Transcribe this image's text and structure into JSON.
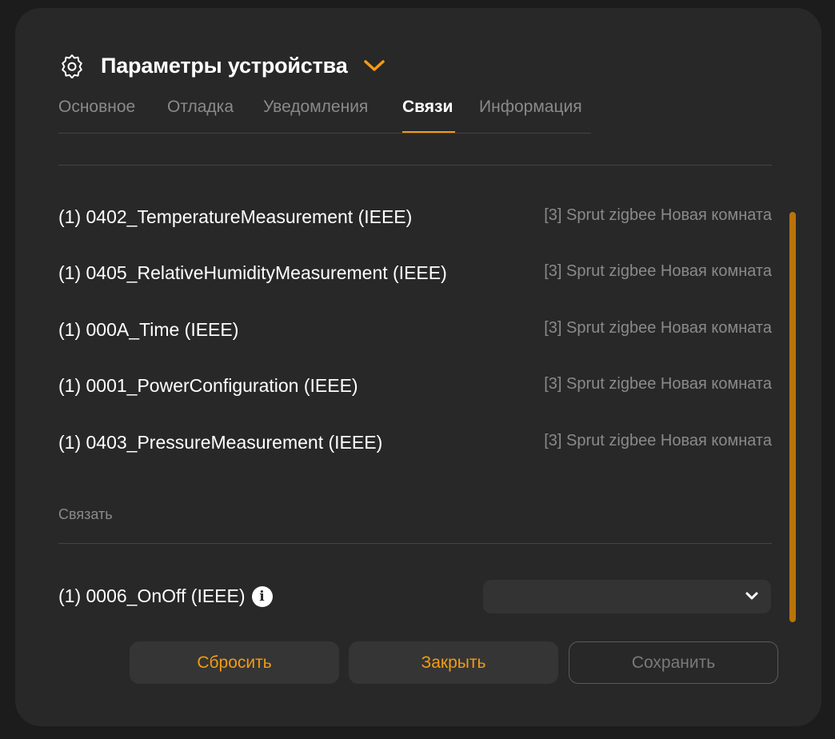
{
  "modal": {
    "title": "Параметры устройства",
    "icons": {
      "settings": "gear-icon",
      "expand": "chevron-down-icon"
    }
  },
  "tabs": [
    {
      "label": "Основное",
      "active": false
    },
    {
      "label": "Отладка",
      "active": false
    },
    {
      "label": "Уведомления",
      "active": false
    },
    {
      "label": "Связи",
      "active": true
    },
    {
      "label": "Информация",
      "active": false
    }
  ],
  "bindings": [
    {
      "name": "(1) 0402_TemperatureMeasurement (IEEE)",
      "target": "[3] Sprut zigbee Новая комната"
    },
    {
      "name": "(1) 0405_RelativeHumidityMeasurement (IEEE)",
      "target": "[3] Sprut zigbee Новая комната"
    },
    {
      "name": "(1) 000A_Time (IEEE)",
      "target": "[3] Sprut zigbee Новая комната"
    },
    {
      "name": "(1) 0001_PowerConfiguration (IEEE)",
      "target": "[3] Sprut zigbee Новая комната"
    },
    {
      "name": "(1) 0403_PressureMeasurement (IEEE)",
      "target": "[3] Sprut zigbee Новая комната"
    }
  ],
  "link_section": {
    "label": "Связать",
    "row_name": "(1) 0006_OnOff (IEEE)",
    "select_value": ""
  },
  "buttons": {
    "reset": "Сбросить",
    "close": "Закрыть",
    "save": "Сохранить"
  },
  "colors": {
    "accent": "#f39c12",
    "modal_bg": "#282828",
    "muted_text": "#8a8a8a"
  }
}
